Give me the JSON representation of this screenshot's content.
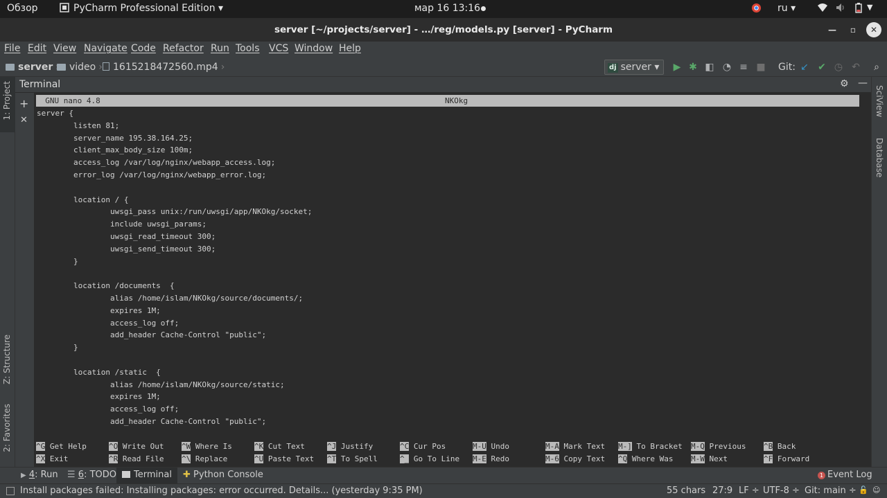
{
  "system_bar": {
    "overview": "Обзор",
    "app_name": "PyCharm Professional Edition ▾",
    "datetime": "мар 16  13:16",
    "language": "ru ▾"
  },
  "window": {
    "title": "server [~/projects/server] - …/reg/models.py [server] - PyCharm"
  },
  "menu": [
    "File",
    "Edit",
    "View",
    "Navigate",
    "Code",
    "Refactor",
    "Run",
    "Tools",
    "VCS",
    "Window",
    "Help"
  ],
  "breadcrumb": {
    "project": "server",
    "folder": "video",
    "file": "1615218472560.mp4"
  },
  "run_config": {
    "label": "server ▾",
    "badge": "dj"
  },
  "git_label": "Git:",
  "left_tabs": {
    "project": "1: Project",
    "structure": "Z: Structure",
    "favorites": "2: Favorites"
  },
  "right_tabs": {
    "sciview": "SciView",
    "database": "Database"
  },
  "terminal": {
    "title": "Terminal",
    "nano_version": "  GNU nano 4.8",
    "nano_file": "NKOkg",
    "lines": [
      "server {",
      "        listen 81;",
      "        server_name 195.38.164.25;",
      "        client_max_body_size 100m;",
      "        access_log /var/log/nginx/webapp_access.log;",
      "        error_log /var/log/nginx/webapp_error.log;",
      "",
      "        location / {",
      "                uwsgi_pass unix:/run/uwsgi/app/NKOkg/socket;",
      "                include uwsgi_params;",
      "                uwsgi_read_timeout 300;",
      "                uwsgi_send_timeout 300;",
      "        }",
      "",
      "        location /documents  {",
      "                alias /home/islam/NKOkg/source/documents/;",
      "                expires 1M;",
      "                access_log off;",
      "                add_header Cache-Control \"public\";",
      "        }",
      "",
      "        location /static  {",
      "                alias /home/islam/NKOkg/source/static;",
      "                expires 1M;",
      "                access_log off;",
      "                add_header Cache-Control \"public\";"
    ],
    "shortcuts_row1": [
      {
        "key": "^G",
        "label": "Get Help"
      },
      {
        "key": "^O",
        "label": "Write Out"
      },
      {
        "key": "^W",
        "label": "Where Is"
      },
      {
        "key": "^K",
        "label": "Cut Text"
      },
      {
        "key": "^J",
        "label": "Justify"
      },
      {
        "key": "^C",
        "label": "Cur Pos"
      },
      {
        "key": "M-U",
        "label": "Undo"
      },
      {
        "key": "M-A",
        "label": "Mark Text"
      },
      {
        "key": "M-]",
        "label": "To Bracket"
      },
      {
        "key": "M-Q",
        "label": "Previous"
      },
      {
        "key": "^B",
        "label": "Back"
      }
    ],
    "shortcuts_row2": [
      {
        "key": "^X",
        "label": "Exit"
      },
      {
        "key": "^R",
        "label": "Read File"
      },
      {
        "key": "^\\",
        "label": "Replace"
      },
      {
        "key": "^U",
        "label": "Paste Text"
      },
      {
        "key": "^T",
        "label": "To Spell"
      },
      {
        "key": "^_",
        "label": "Go To Line"
      },
      {
        "key": "M-E",
        "label": "Redo"
      },
      {
        "key": "M-6",
        "label": "Copy Text"
      },
      {
        "key": "^Q",
        "label": "Where Was"
      },
      {
        "key": "M-W",
        "label": "Next"
      },
      {
        "key": "^F",
        "label": "Forward"
      }
    ]
  },
  "bottom_tabs": {
    "run_num": "4",
    "run": ": Run",
    "todo_num": "6",
    "todo": ": TODO",
    "terminal": "Terminal",
    "python_console": "Python Console",
    "event_log": "Event Log",
    "event_count": "1"
  },
  "status": {
    "message": "Install packages failed: Installing packages: error occurred. Details... (yesterday 9:35 PM)",
    "chars": "55 chars",
    "position": "27:9",
    "line_sep": "LF ÷",
    "encoding": "UTF-8 ÷",
    "git_branch": "Git: main ÷"
  },
  "colors": {
    "editor_bg": "#2b2b2b",
    "panel_bg": "#3c3f41",
    "run_green": "#59a869",
    "git_blue": "#3592c4",
    "error_red": "#c75450"
  }
}
